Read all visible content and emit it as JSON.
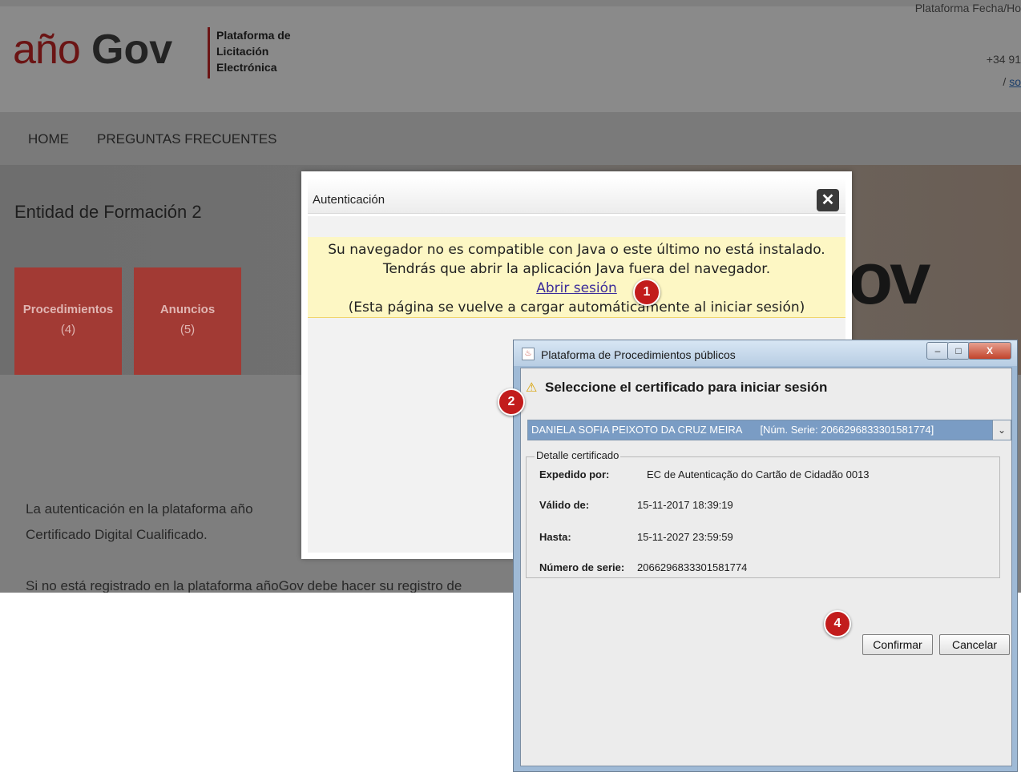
{
  "header": {
    "logo_ano": "año",
    "logo_gov": "Gov",
    "logo_tagline": [
      "Plataforma de",
      "Licitación",
      "Electrónica"
    ],
    "top_right_line1": "Plataforma Fecha/Ho",
    "top_right_phone": "+34 91",
    "top_right_link_prefix": "/ ",
    "top_right_link": "so"
  },
  "nav": {
    "items": [
      "HOME",
      "PREGUNTAS FRECUENTES"
    ]
  },
  "hero": {
    "title": "Entidad de Formación 2",
    "tiles": [
      {
        "label": "Procedimientos",
        "count": "(4)"
      },
      {
        "label": "Anuncios",
        "count": "(5)"
      }
    ],
    "banner_text": "ov"
  },
  "content": {
    "para1_line1": "La  autenticación  en  la  plataforma  año",
    "para1_line2": "Certificado Digital Cualificado.",
    "para2": "Si no está registrado en la plataforma añoGov debe hacer su registro de"
  },
  "auth_modal": {
    "title": "Autenticación",
    "close_symbol": "✕",
    "warning_line1": "Su navegador no es compatible con Java o este último no está instalado.",
    "warning_line2": "Tendrás que abrir la aplicación Java fuera del navegador.",
    "open_session_link": "Abrir sesión",
    "warning_line3": "(Esta página se vuelve a cargar automáticamente al iniciar sesión)"
  },
  "java_dialog": {
    "title": "Plataforma de Procedimientos públicos",
    "heading": "Seleccione el certificado para iniciar sesión",
    "certificate_holder": "DANIELA SOFIA PEIXOTO DA CRUZ MEIRA",
    "certificate_serial_display": "[Núm. Serie: 2066296833301581774]",
    "detail_legend": "Detalle certificado",
    "details": [
      {
        "label": "Expedido por:",
        "value": "EC de Autenticação do Cartão de Cidadão 0013"
      },
      {
        "label": "Válido de:",
        "value": "15-11-2017 18:39:19"
      },
      {
        "label": "Hasta:",
        "value": "15-11-2027 23:59:59"
      },
      {
        "label": "Número de serie:",
        "value": "2066296833301581774"
      }
    ],
    "confirm_label": "Confirmar",
    "cancel_label": "Cancelar",
    "minimize_symbol": "–",
    "maximize_symbol": "□",
    "close_symbol": "X"
  },
  "callouts": [
    "1",
    "2",
    "4"
  ],
  "colors": {
    "brand_red": "#6b1414",
    "tile_red": "#a23a34",
    "warning_bg": "#fdf7c4",
    "badge_red": "#c21c1c",
    "combo_selected": "#7a9cc4"
  }
}
